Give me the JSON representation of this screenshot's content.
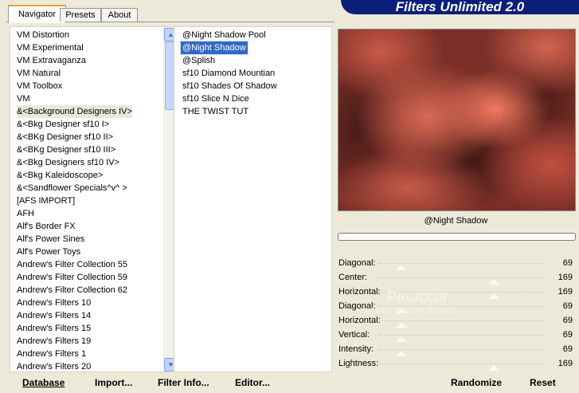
{
  "tabs": [
    "Navigator",
    "Presets",
    "About"
  ],
  "banner": "Filters Unlimited 2.0",
  "categories": [
    "VM Distortion",
    "VM Experimental",
    "VM Extravaganza",
    "VM Natural",
    "VM Toolbox",
    "VM",
    "&<Background Designers IV>",
    "&<Bkg Designer sf10 I>",
    "&<BKg Designer sf10 II>",
    "&<BKg Designer sf10 III>",
    "&<Bkg Designers sf10 IV>",
    "&<Bkg Kaleidoscope>",
    "&<Sandflower Specials^v^ >",
    "[AFS IMPORT]",
    "AFH",
    "Alf's Border FX",
    "Alf's Power Sines",
    "Alf's Power Toys",
    "Andrew's Filter Collection 55",
    "Andrew's Filter Collection 59",
    "Andrew's Filter Collection 62",
    "Andrew's Filters 10",
    "Andrew's Filters 14",
    "Andrew's Filters 15",
    "Andrew's Filters 19",
    "Andrew's Filters 1",
    "Andrew's Filters 20"
  ],
  "filters": [
    "@Night Shadow Pool",
    "@Night Shadow",
    "@Splish",
    "sf10 Diamond Mountian",
    "sf10 Shades Of Shadow",
    "sf10 Slice N Dice",
    "THE TWIST TUT"
  ],
  "selected_filter": "@Night Shadow",
  "sliders": [
    {
      "label": "Diagonal:",
      "value": "69"
    },
    {
      "label": "Center:",
      "value": "169"
    },
    {
      "label": "Horizontal:",
      "value": "169"
    },
    {
      "label": "Diagonal:",
      "value": "69"
    },
    {
      "label": "Horizontal:",
      "value": "69"
    },
    {
      "label": "Vertical:",
      "value": "69"
    },
    {
      "label": "Intensity:",
      "value": "69"
    },
    {
      "label": "Lightness:",
      "value": "169"
    }
  ],
  "watermark": {
    "name": "Pinuccia",
    "url": "www.maidiregrafica.eu"
  },
  "buttons": {
    "database": "Database",
    "import": "Import...",
    "filter_info": "Filter Info...",
    "editor": "Editor...",
    "randomize": "Randomize",
    "reset": "Reset"
  },
  "colors": {
    "selection": "#316ac5",
    "banner": "#0b1f7a",
    "tab_accent": "#e9a232"
  },
  "icons": {
    "scroll_up": "scroll-up-arrow-icon",
    "scroll_down": "scroll-down-arrow-icon"
  }
}
